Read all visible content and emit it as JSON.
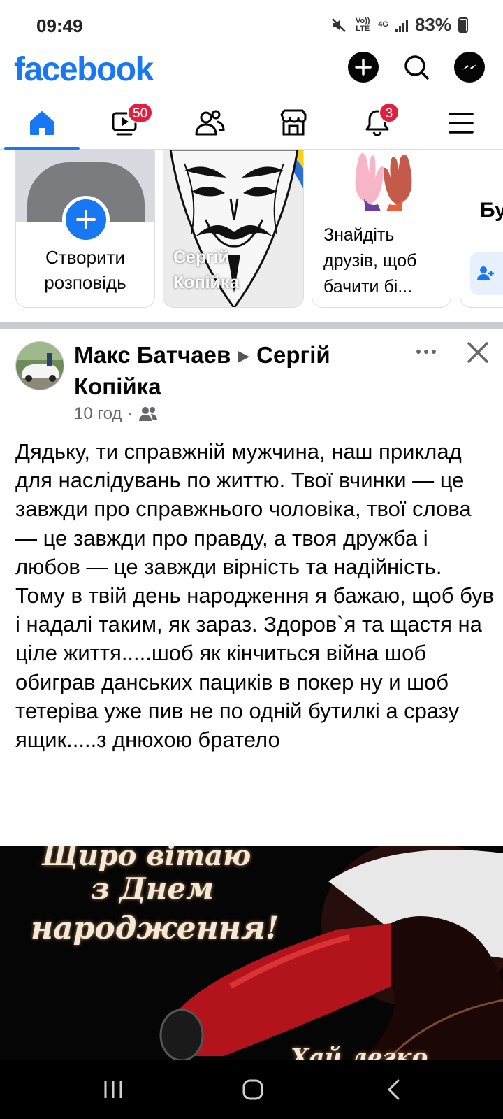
{
  "status_bar": {
    "time": "09:49",
    "volte": "Vo)) LTE",
    "network": "4G",
    "battery": "83%"
  },
  "header": {
    "logo": "facebook",
    "brand_color": "#1877f2",
    "icons": [
      "plus-icon",
      "search-icon",
      "messenger-icon"
    ]
  },
  "tabs": [
    {
      "name": "home",
      "icon": "home-icon",
      "active": true
    },
    {
      "name": "video",
      "icon": "video-icon",
      "badge": "50"
    },
    {
      "name": "friends",
      "icon": "friends-icon"
    },
    {
      "name": "marketplace",
      "icon": "marketplace-icon"
    },
    {
      "name": "notifications",
      "icon": "bell-icon",
      "badge": "3"
    },
    {
      "name": "menu",
      "icon": "menu-icon"
    }
  ],
  "stories": {
    "create_label": "Створити розповідь",
    "user_story_name": "Сергій Копійка",
    "find_friends_text": "Знайдіть друзів, щоб бачити бі...",
    "peek_text": "Бу"
  },
  "post": {
    "author": "Макс Батчаев",
    "target": "Сергій Копійка",
    "time": "10 год",
    "audience_icon": "friends-icon",
    "text": "Дядьку, ти справжній мужчина, наш приклад для наслідувань по життю. Твої вчинки — це завжди про справжнього чоловіка, твої слова — це завжди про правду, а твоя дружба і любов — це завжди вірність та надійність. Тому в твій день народження я бажаю, щоб був і надалі таким, як зараз. Здоров`я та щастя на ціле життя.....шоб як кінчиться війна шоб обиграв данських пациків в покер ну и шоб тетеріва уже пив не по одній бутилкі а сразу ящик.....з днюхою братело",
    "image_text": {
      "line1": "Щиро вітаю",
      "line2": "з Днем",
      "line3": "народження!",
      "line4": "Хай легко"
    }
  },
  "badge_color": "#e41e3f"
}
